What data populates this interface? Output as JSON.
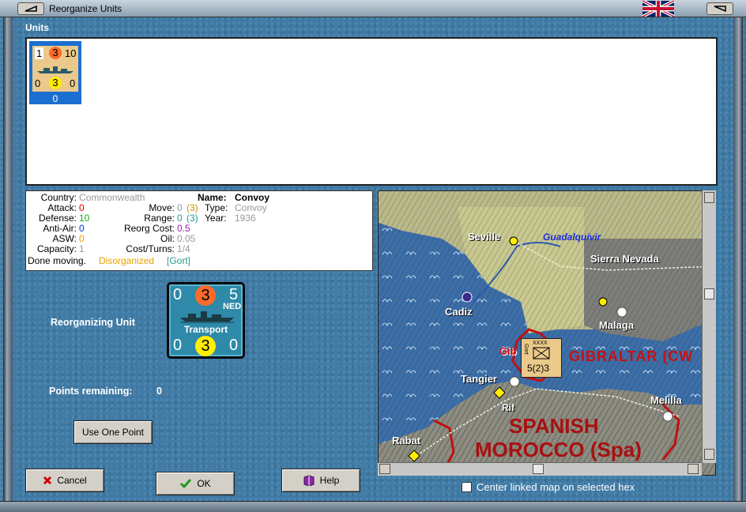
{
  "window": {
    "title": "Reorganize Units"
  },
  "units": {
    "label": "Units",
    "card": {
      "top_left": "1",
      "top_mid": "3",
      "top_right": "10",
      "bot_left": "0",
      "bot_mid": "3",
      "bot_right": "0",
      "index": "0"
    }
  },
  "info": {
    "country_label": "Country:",
    "country": "Commonwealth",
    "attack_label": "Attack:",
    "attack": "0",
    "defense_label": "Defense:",
    "defense": "10",
    "antiair_label": "Anti-Air:",
    "antiair": "0",
    "asw_label": "ASW:",
    "asw": "0",
    "capacity_label": "Capacity:",
    "capacity": "1",
    "status": "Done moving.",
    "status_disorg": "Disorganized",
    "status_leader": "[Gort]",
    "move_label": "Move:",
    "move": "0",
    "move_paren": "(3)",
    "range_label": "Range:",
    "range": "0",
    "range_paren": "(3)",
    "reorg_label": "Reorg Cost:",
    "reorg": "0.5",
    "oil_label": "Oil:",
    "oil": "0.05",
    "costturns_label": "Cost/Turns:",
    "costturns": "1/4",
    "name_label": "Name:",
    "name": "Convoy",
    "type_label": "Type:",
    "type": "Convoy",
    "year_label": "Year:",
    "year": "1936"
  },
  "reorg": {
    "label": "Reorganizing Unit",
    "points_label": "Points remaining:",
    "points": "0",
    "use_point": "Use One Point"
  },
  "big_unit": {
    "top_left": "0",
    "top_mid": "3",
    "top_right": "5",
    "nationality": "NED",
    "type": "Transport",
    "bot_left": "0",
    "bot_mid": "3",
    "bot_right": "0"
  },
  "buttons": {
    "cancel": "Cancel",
    "ok": "OK",
    "help": "Help"
  },
  "map": {
    "labels": {
      "seville": "Seville",
      "guadalquivir": "Guadalquivir",
      "sierra": "Sierra Nevada",
      "cadiz": "Cadiz",
      "malaga": "Malaga",
      "gib": "Gib",
      "gibraltar": "GIBRALTAR (CW",
      "tangier": "Tangier",
      "rif": "Rif",
      "melilla": "Melilla",
      "rabat": "Rabat",
      "spanish": "SPANISH",
      "morocco": "MOROCCO (Spa)"
    },
    "counter": {
      "top": "XXXX",
      "side": "Gort",
      "value": "5(2)3"
    },
    "center_label": "Center linked map on selected hex"
  },
  "colors": {
    "accent": "#1a6fd1",
    "orange": "#ff6a2a",
    "yellow": "#ffee00",
    "green": "#22aa22",
    "disorg": "#e8a000",
    "leader": "#2a9a8a"
  }
}
